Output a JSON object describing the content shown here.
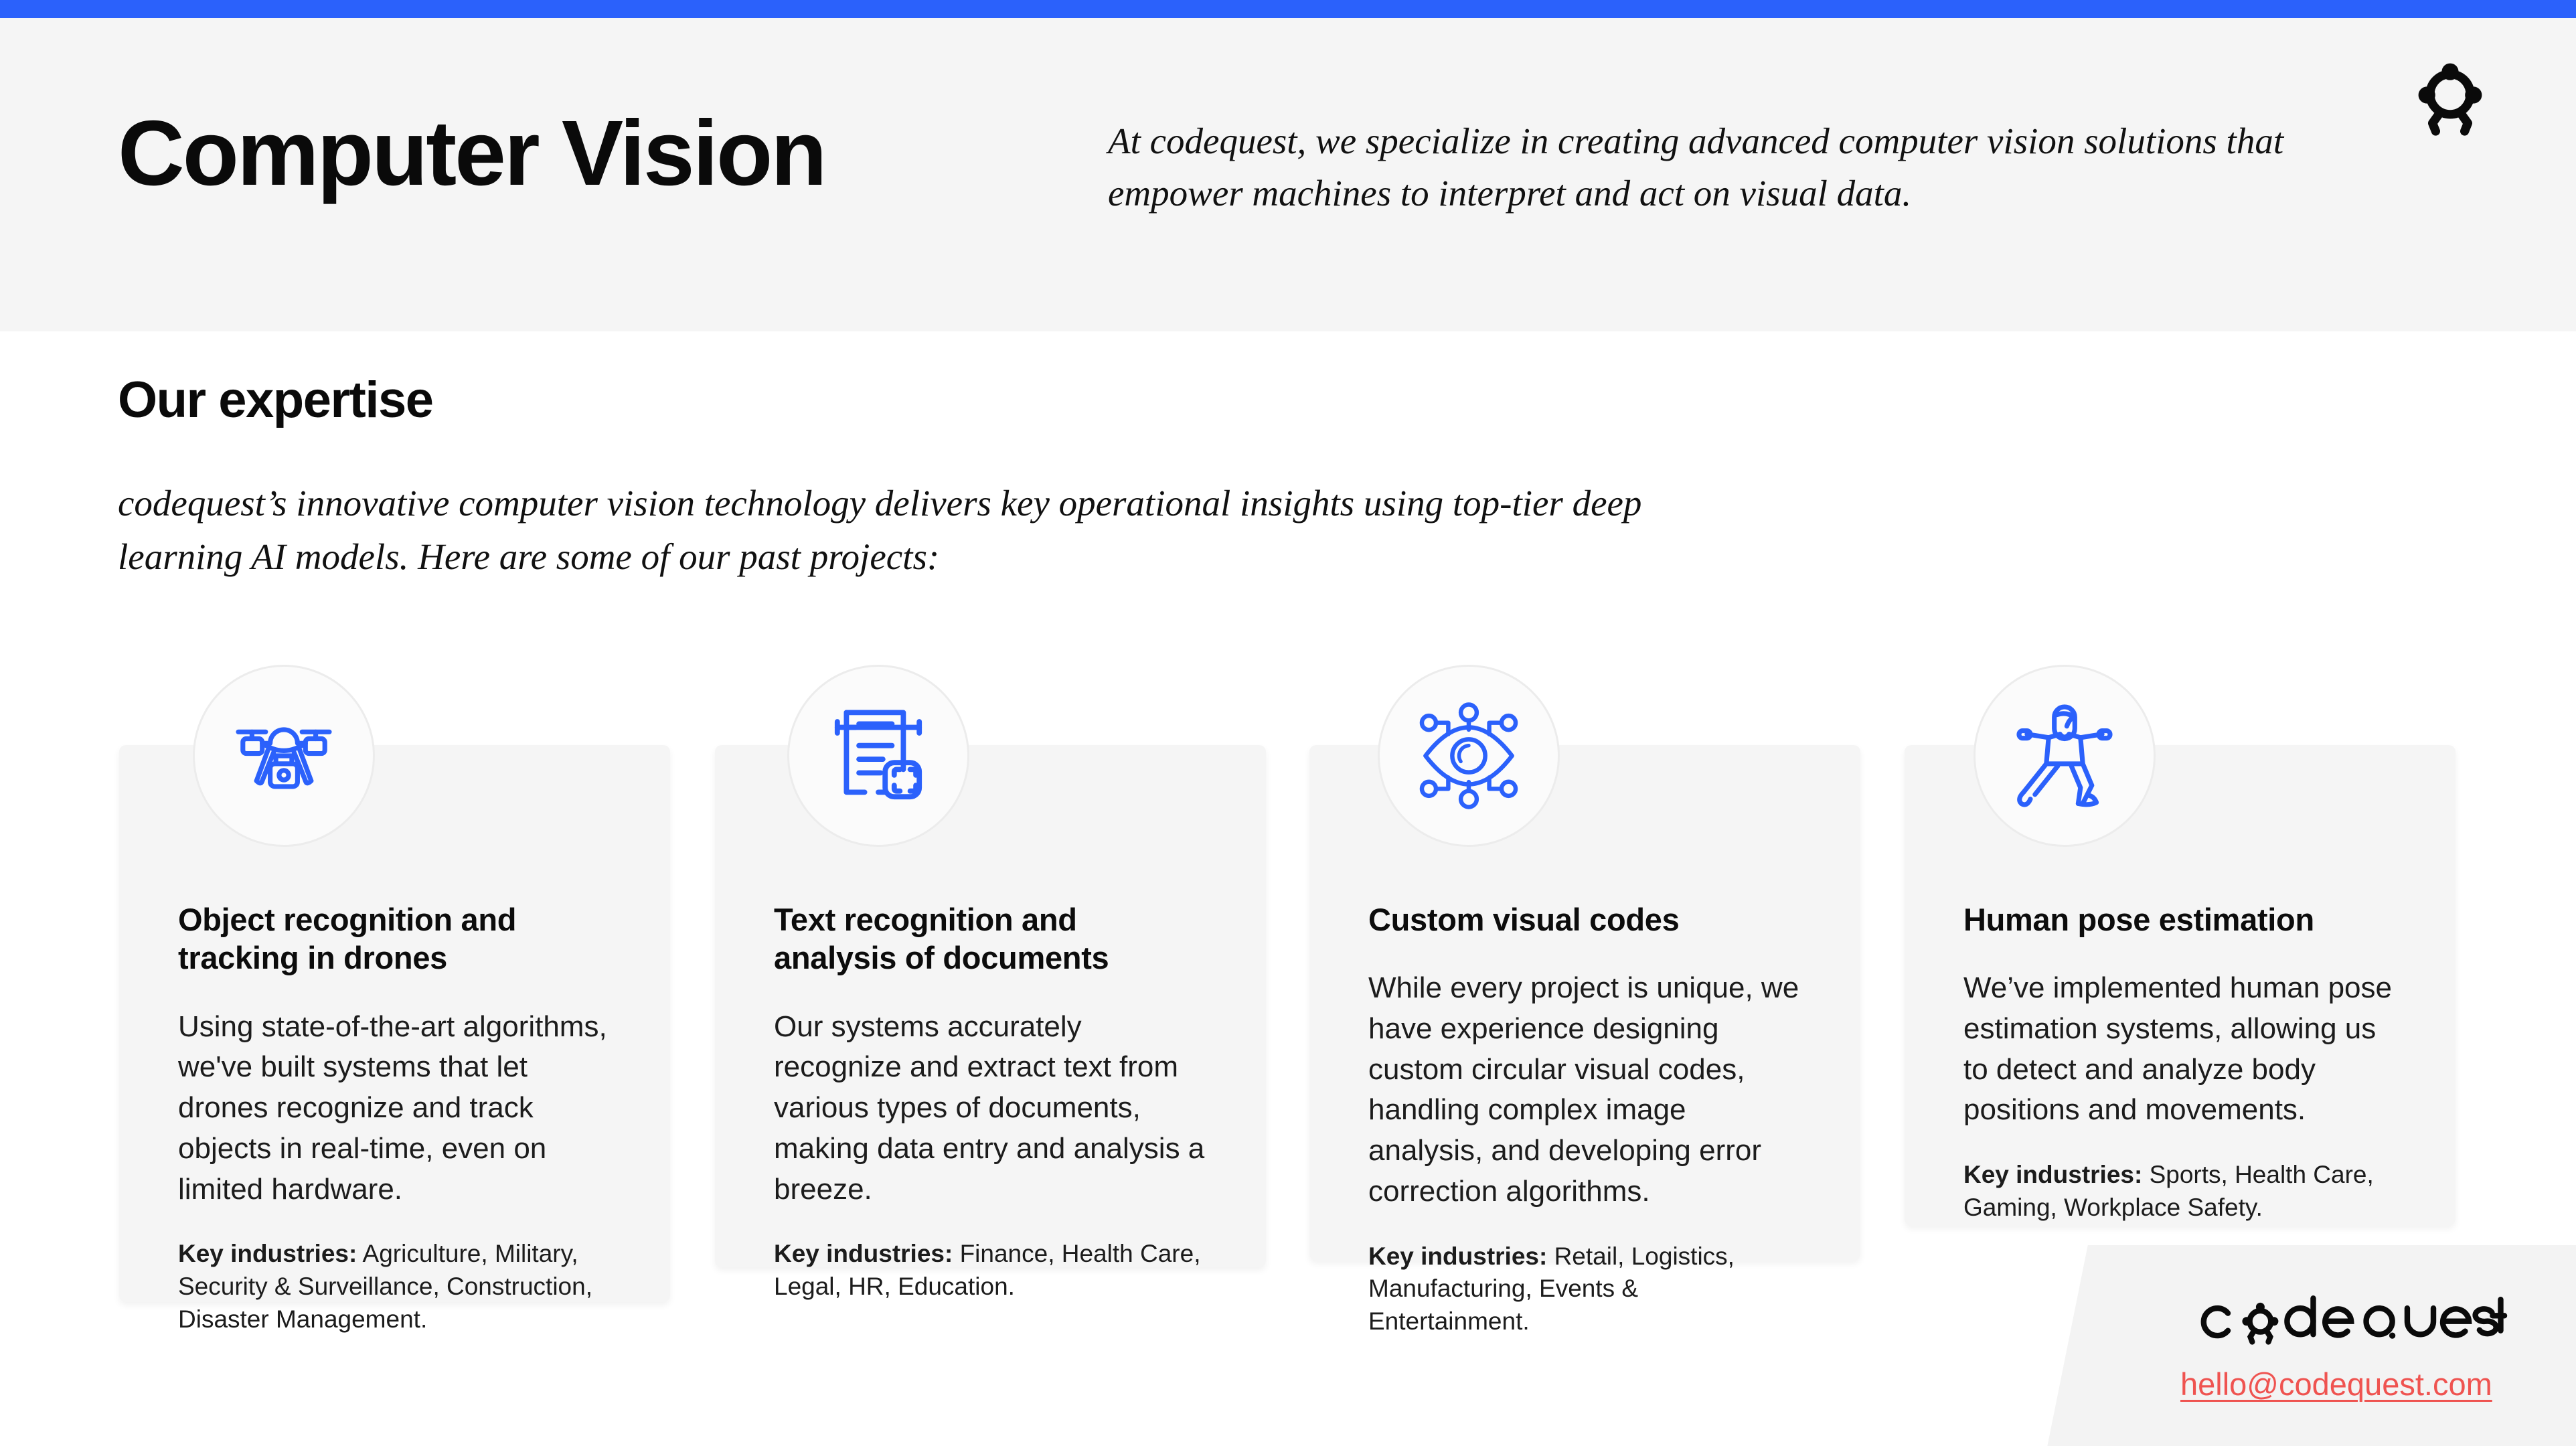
{
  "theme": {
    "accent_blue": "#2b61fb",
    "band_grey": "#f5f5f5",
    "card_grey": "#f5f5f5",
    "link_red": "#ef5350",
    "text_black": "#0a0a0a"
  },
  "header": {
    "title": "Computer Vision",
    "subtitle": "At codequest, we specialize in creating advanced computer vision solutions that empower machines to interpret and act on visual data.",
    "logo_icon": "codequest-mark-icon"
  },
  "expertise": {
    "heading": "Our expertise",
    "lede": "codequest’s innovative computer vision technology delivers key operational insights using top-tier deep learning AI models. Here are some of our past projects:"
  },
  "cards": [
    {
      "icon": "drone-icon",
      "title": "Object recognition and tracking in drones",
      "body": "Using state-of-the-art algorithms, we've built systems that let drones recognize and track objects in real-time, even on limited hardware.",
      "industries_label": "Key industries:",
      "industries_value": " Agriculture, Military, Security & Surveillance, Construction, Disaster Management."
    },
    {
      "icon": "document-scan-icon",
      "title": "Text recognition and analysis of documents",
      "body": "Our systems accurately recognize and extract text from various types of documents, making data entry and analysis a breeze.",
      "industries_label": "Key industries:",
      "industries_value": " Finance, Health Care, Legal, HR, Education."
    },
    {
      "icon": "eye-network-icon",
      "title": "Custom visual codes",
      "body": "While every project is unique, we have experience designing custom circular visual codes, handling complex image analysis, and developing error correction algorithms.",
      "industries_label": "Key industries:",
      "industries_value": " Retail, Logistics, Manufacturing, Events & Entertainment."
    },
    {
      "icon": "human-pose-icon",
      "title": "Human pose estimation",
      "body": "We’ve implemented human pose estimation systems, allowing us to detect and analyze body positions and movements.",
      "industries_label": "Key industries:",
      "industries_value": " Sports, Health Care, Gaming, Workplace Safety."
    }
  ],
  "footer": {
    "wordmark": "codequest",
    "email": "hello@codequest.com"
  }
}
